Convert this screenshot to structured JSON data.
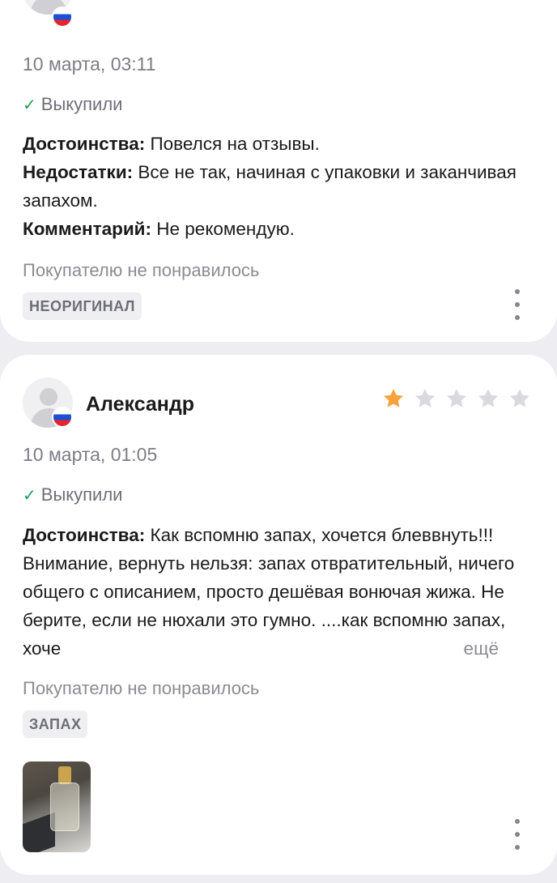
{
  "review1": {
    "date": "10 марта, 03:11",
    "status": "Выкупили",
    "pros_label": "Достоинства:",
    "pros_text": "Повелся на отзывы.",
    "cons_label": "Недостатки:",
    "cons_text": "Все не так, начиная с упаковки и заканчивая запахом.",
    "comment_label": "Комментарий:",
    "comment_text": "Не рекомендую.",
    "verdict": "Покупателю не понравилось",
    "tag": "НЕОРИГИНАЛ"
  },
  "review2": {
    "author": "Александр",
    "rating": 1,
    "max_rating": 5,
    "date": "10 марта, 01:05",
    "status": "Выкупили",
    "pros_label": "Достоинства:",
    "pros_text": "Как вспомню запах, хочется блеввнуть!!! Внимание, вернуть нельзя: запах отвратительный, ничего общего с описанием, просто дешёвая вонючая жижа. Не берите, если не нюхали это гумно. ....как вспомню запах, хоче",
    "more": "ещё",
    "verdict": "Покупателю не понравилось",
    "tag": "ЗАПАХ"
  },
  "colors": {
    "star_filled": "#f7a23c",
    "star_empty": "#d9d9de",
    "check": "#1fa055",
    "flag": [
      "#ffffff",
      "#1c4fd6",
      "#e5242b"
    ]
  },
  "icons": {
    "avatar": "user-silhouette-icon",
    "flag": "russia-flag-icon",
    "check": "check-icon",
    "star": "star-icon",
    "menu": "kebab-menu-icon"
  }
}
